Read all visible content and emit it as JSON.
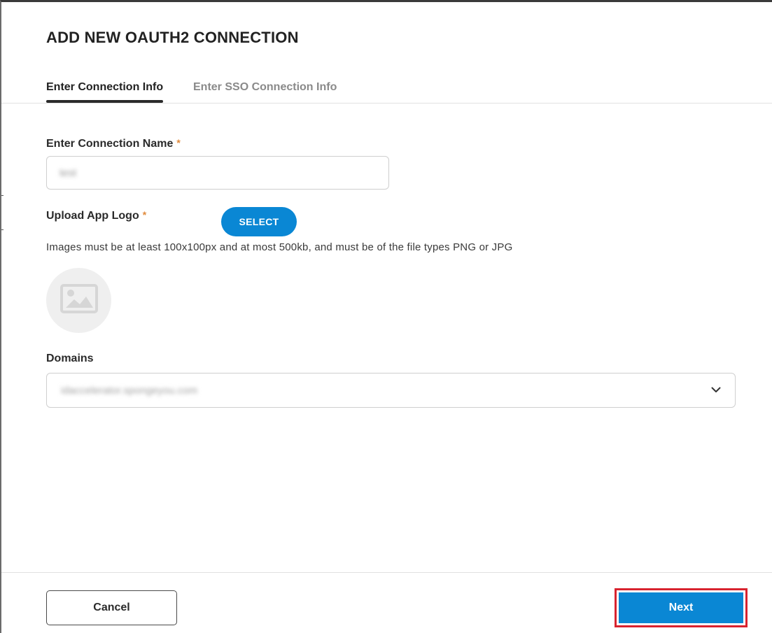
{
  "dialog": {
    "title": "ADD NEW OAUTH2 CONNECTION"
  },
  "tabs": [
    {
      "label": "Enter Connection Info",
      "active": true
    },
    {
      "label": "Enter SSO Connection Info",
      "active": false
    }
  ],
  "connection_name": {
    "label": "Enter Connection Name",
    "required_mark": "*",
    "value": "test"
  },
  "app_logo": {
    "label": "Upload App Logo",
    "required_mark": "*",
    "select_label": "SELECT",
    "hint": "Images must be at least 100x100px and at most 500kb, and must be of the file types PNG or JPG",
    "placeholder_icon": "image-icon"
  },
  "domains": {
    "label": "Domains",
    "selected_value": "idaccelerator.spongeyou.com",
    "dropdown_icon": "chevron-down-icon"
  },
  "footer": {
    "cancel_label": "Cancel",
    "next_label": "Next"
  },
  "colors": {
    "primary": "#0a87d4",
    "required": "#e08a3c",
    "highlight": "#d8232f"
  }
}
